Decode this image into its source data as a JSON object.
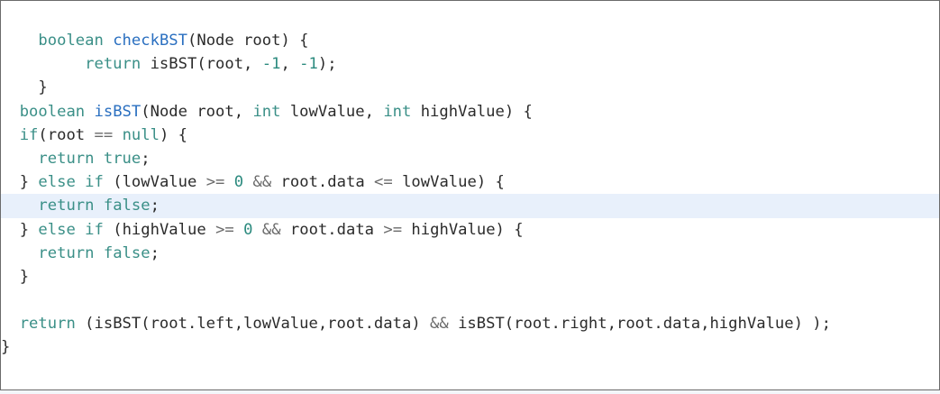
{
  "editor": {
    "active_line_index": 7,
    "lines": [
      [
        {
          "t": "    "
        },
        {
          "t": "boolean",
          "c": "kw"
        },
        {
          "t": " "
        },
        {
          "t": "checkBST",
          "c": "fn"
        },
        {
          "t": "(Node root) {"
        }
      ],
      [
        {
          "t": "         "
        },
        {
          "t": "return",
          "c": "kw"
        },
        {
          "t": " isBST(root, "
        },
        {
          "t": "-1",
          "c": "num"
        },
        {
          "t": ", "
        },
        {
          "t": "-1",
          "c": "num"
        },
        {
          "t": ");"
        }
      ],
      [
        {
          "t": "    }"
        }
      ],
      [
        {
          "t": "  "
        },
        {
          "t": "boolean",
          "c": "kw"
        },
        {
          "t": " "
        },
        {
          "t": "isBST",
          "c": "fn"
        },
        {
          "t": "(Node root, "
        },
        {
          "t": "int",
          "c": "kw"
        },
        {
          "t": " lowValue, "
        },
        {
          "t": "int",
          "c": "kw"
        },
        {
          "t": " highValue) {"
        }
      ],
      [
        {
          "t": "  "
        },
        {
          "t": "if",
          "c": "kw"
        },
        {
          "t": "(root "
        },
        {
          "t": "==",
          "c": "op"
        },
        {
          "t": " "
        },
        {
          "t": "null",
          "c": "kw"
        },
        {
          "t": ") {"
        }
      ],
      [
        {
          "t": "    "
        },
        {
          "t": "return",
          "c": "kw"
        },
        {
          "t": " "
        },
        {
          "t": "true",
          "c": "kw"
        },
        {
          "t": ";"
        }
      ],
      [
        {
          "t": "  } "
        },
        {
          "t": "else",
          "c": "kw"
        },
        {
          "t": " "
        },
        {
          "t": "if",
          "c": "kw"
        },
        {
          "t": " (lowValue "
        },
        {
          "t": ">=",
          "c": "op"
        },
        {
          "t": " "
        },
        {
          "t": "0",
          "c": "num"
        },
        {
          "t": " "
        },
        {
          "t": "&&",
          "c": "op"
        },
        {
          "t": " root.data "
        },
        {
          "t": "<=",
          "c": "op"
        },
        {
          "t": " lowValue) {"
        }
      ],
      [
        {
          "t": "    "
        },
        {
          "t": "return",
          "c": "kw"
        },
        {
          "t": " "
        },
        {
          "t": "false",
          "c": "kw"
        },
        {
          "t": ";"
        }
      ],
      [
        {
          "t": "  } "
        },
        {
          "t": "else",
          "c": "kw"
        },
        {
          "t": " "
        },
        {
          "t": "if",
          "c": "kw"
        },
        {
          "t": " (highValue "
        },
        {
          "t": ">=",
          "c": "op"
        },
        {
          "t": " "
        },
        {
          "t": "0",
          "c": "num"
        },
        {
          "t": " "
        },
        {
          "t": "&&",
          "c": "op"
        },
        {
          "t": " root.data "
        },
        {
          "t": ">=",
          "c": "op"
        },
        {
          "t": " highValue) {"
        }
      ],
      [
        {
          "t": "    "
        },
        {
          "t": "return",
          "c": "kw"
        },
        {
          "t": " "
        },
        {
          "t": "false",
          "c": "kw"
        },
        {
          "t": ";"
        }
      ],
      [
        {
          "t": "  }"
        }
      ],
      [
        {
          "t": ""
        }
      ],
      [
        {
          "t": "  "
        },
        {
          "t": "return",
          "c": "kw"
        },
        {
          "t": " (isBST(root.left,lowValue,root.data) "
        },
        {
          "t": "&&",
          "c": "op"
        },
        {
          "t": " isBST(root.right,root.data,highValue) );"
        }
      ],
      [
        {
          "t": "}"
        }
      ]
    ]
  },
  "colors": {
    "keyword": "#3a8f87",
    "function_name": "#2a6fc0",
    "number": "#2b8a7e",
    "active_line_background": "#e8f0fb"
  }
}
